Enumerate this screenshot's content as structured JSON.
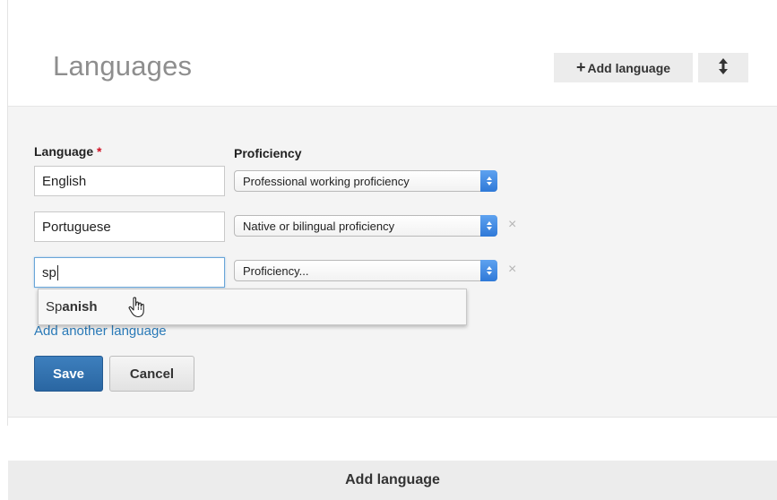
{
  "header": {
    "title": "Languages",
    "add_button_label": "Add language",
    "add_button_icon": "plus-icon",
    "reorder_icon": "up-down-arrow-icon"
  },
  "form": {
    "language_label": "Language",
    "required_marker": "*",
    "proficiency_label": "Proficiency",
    "rows": [
      {
        "language": "English",
        "proficiency": "Professional working proficiency",
        "removable": false
      },
      {
        "language": "Portuguese",
        "proficiency": "Native or bilingual proficiency",
        "removable": true
      },
      {
        "language": "sp",
        "proficiency": "Proficiency...",
        "removable": true
      }
    ],
    "remove_glyph": "×",
    "add_another_label": "Add another language",
    "save_label": "Save",
    "cancel_label": "Cancel"
  },
  "autocomplete": {
    "typed": "Sp",
    "rest": "anish"
  },
  "footer": {
    "label": "Add language"
  },
  "colors": {
    "accent": "#2a66a2",
    "link": "#2a7ab8",
    "required": "#d11124",
    "select_arrow": "#3b86e3"
  }
}
